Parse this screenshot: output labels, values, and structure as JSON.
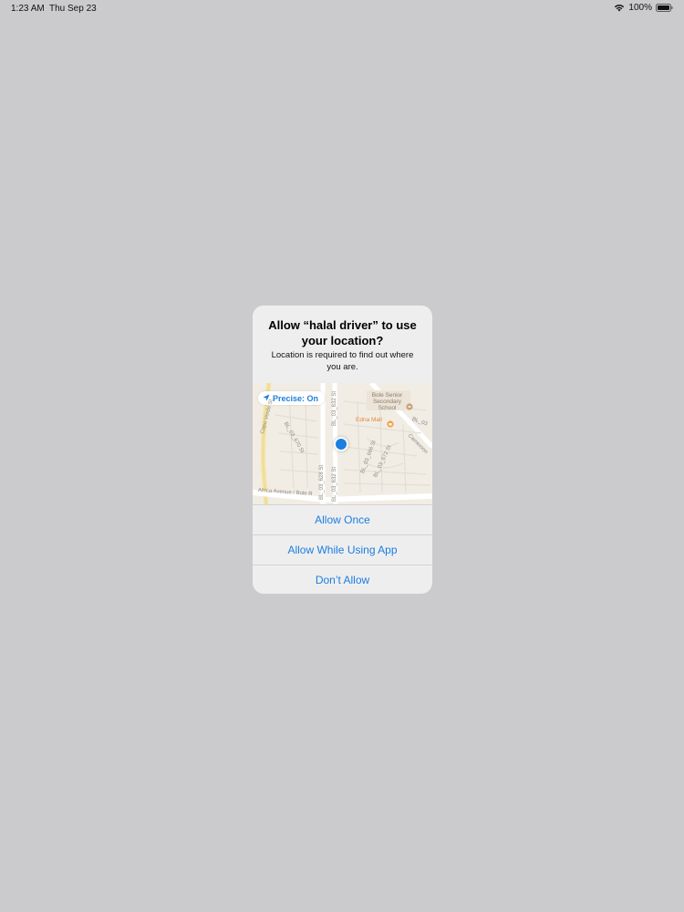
{
  "status_bar": {
    "time": "1:23 AM",
    "date": "Thu Sep 23",
    "battery": "100%"
  },
  "alert": {
    "title": "Allow “halal driver” to use your location?",
    "message": "Location is required to find out where you are.",
    "precise_label": "Precise: On",
    "map": {
      "streets": [
        "Capo Verde St",
        "BL_03_632 St",
        "BL_03_628 St",
        "BL_03_632 St",
        "BL_03_670 St",
        "BL_03_666 St",
        "BL_03_672 St",
        "Cameroon",
        "Africa Avenue / Bole R",
        "BL_03"
      ],
      "pois": {
        "school": "Bole Senior Secondary School",
        "mall": "Edna Mall"
      }
    },
    "buttons": {
      "allow_once": "Allow Once",
      "allow_while_using": "Allow While Using App",
      "dont_allow": "Don’t Allow"
    }
  },
  "colors": {
    "background": "#cbcacd",
    "accent": "#1a7fe0",
    "alert_bg": "#efeeef"
  }
}
